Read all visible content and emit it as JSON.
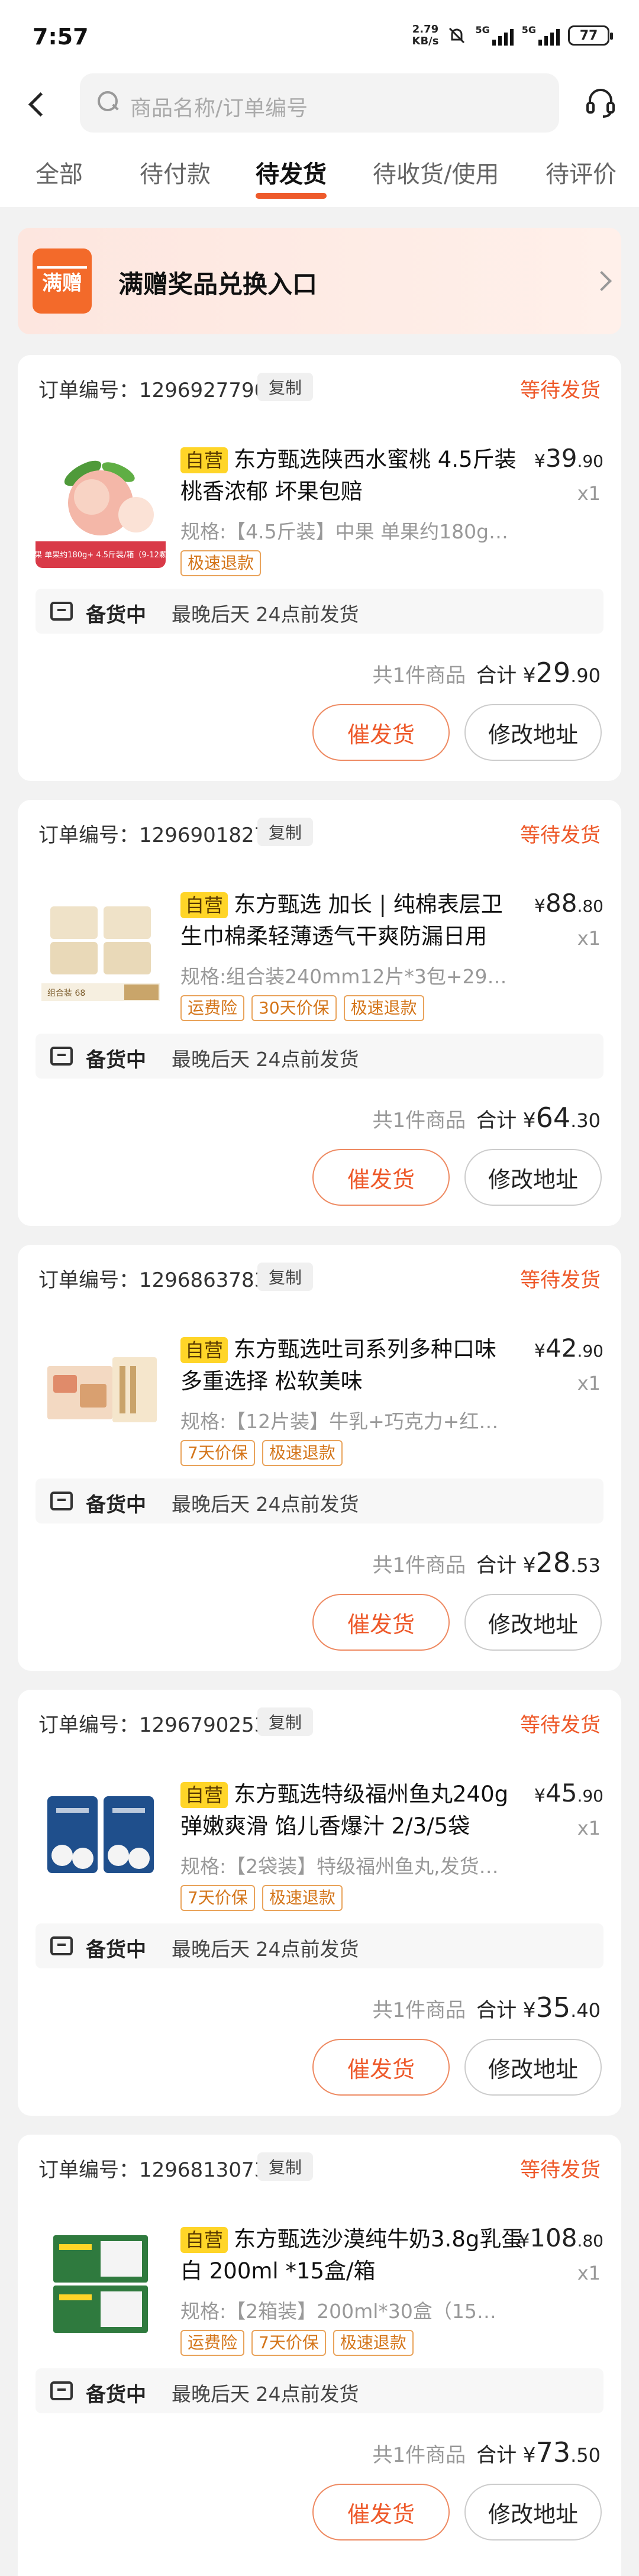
{
  "status_bar": {
    "time": "7:57",
    "net_speed": "2.79",
    "net_unit": "KB/s",
    "net1": "5G",
    "net2": "5G",
    "battery": "77"
  },
  "search": {
    "placeholder": "商品名称/订单编号"
  },
  "tabs": [
    "全部",
    "待付款",
    "待发货",
    "待收货/使用",
    "待评价"
  ],
  "active_tab": 2,
  "promo": {
    "badge": "满赠",
    "title": "满赠奖品兑换入口"
  },
  "common": {
    "copy": "复制",
    "state": "等待发货",
    "self": "自营",
    "prep_label": "备货中",
    "prep_text": "最晚后天 24点前发货",
    "count": "共1件商品",
    "total_label": "合计",
    "urge": "催发货",
    "address": "修改地址",
    "currency": "¥"
  },
  "orders": [
    {
      "order_no": "订单编号：1296927790...",
      "title": "东方甄选陕西水蜜桃 4.5斤装 桃香浓郁 坏果包赔",
      "spec": "规格:【4.5斤装】中果 单果约180g+...",
      "tags": [
        "极速退款"
      ],
      "price_int": "39",
      "price_dec": ".90",
      "qty": "x1",
      "total_int": "29",
      "total_dec": ".90",
      "thumb_text": "中果 单果约180g+ 4.5斤装/箱（9-12颗）"
    },
    {
      "order_no": "订单编号：1296901827...",
      "title": "东方甄选 加长 | 纯棉表层卫生巾棉柔轻薄透气干爽防漏日用",
      "spec": "规格:组合装240mm12片*3包+290m...",
      "tags": [
        "运费险",
        "30天价保",
        "极速退款"
      ],
      "price_int": "88",
      "price_dec": ".80",
      "qty": "x1",
      "total_int": "64",
      "total_dec": ".30",
      "thumb_text": "组合装 68"
    },
    {
      "order_no": "订单编号：1296863783...",
      "title": "东方甄选吐司系列多种口味 多重选择 松软美味",
      "spec": "规格:【12片装】牛乳+巧克力+红豆吐...",
      "tags": [
        "7天价保",
        "极速退款"
      ],
      "price_int": "42",
      "price_dec": ".90",
      "qty": "x1",
      "total_int": "28",
      "total_dec": ".53",
      "thumb_text": ""
    },
    {
      "order_no": "订单编号：1296790253...",
      "title": "东方甄选特级福州鱼丸240g 弹嫩爽滑 馅儿香爆汁 2/3/5袋",
      "spec": "规格:【2袋装】特级福州鱼丸,发货时...",
      "tags": [
        "7天价保",
        "极速退款"
      ],
      "price_int": "45",
      "price_dec": ".90",
      "qty": "x1",
      "total_int": "35",
      "total_dec": ".40",
      "thumb_text": ""
    },
    {
      "order_no": "订单编号：1296813073...",
      "title": "东方甄选沙漠纯牛奶3.8g乳蛋白 200ml *15盒/箱",
      "spec": "规格:【2箱装】200ml*30盒（15盒/...",
      "tags": [
        "运费险",
        "7天价保",
        "极速退款"
      ],
      "price_int": "108",
      "price_dec": ".80",
      "qty": "x1",
      "total_int": "73",
      "total_dec": ".50",
      "thumb_text": ""
    }
  ]
}
